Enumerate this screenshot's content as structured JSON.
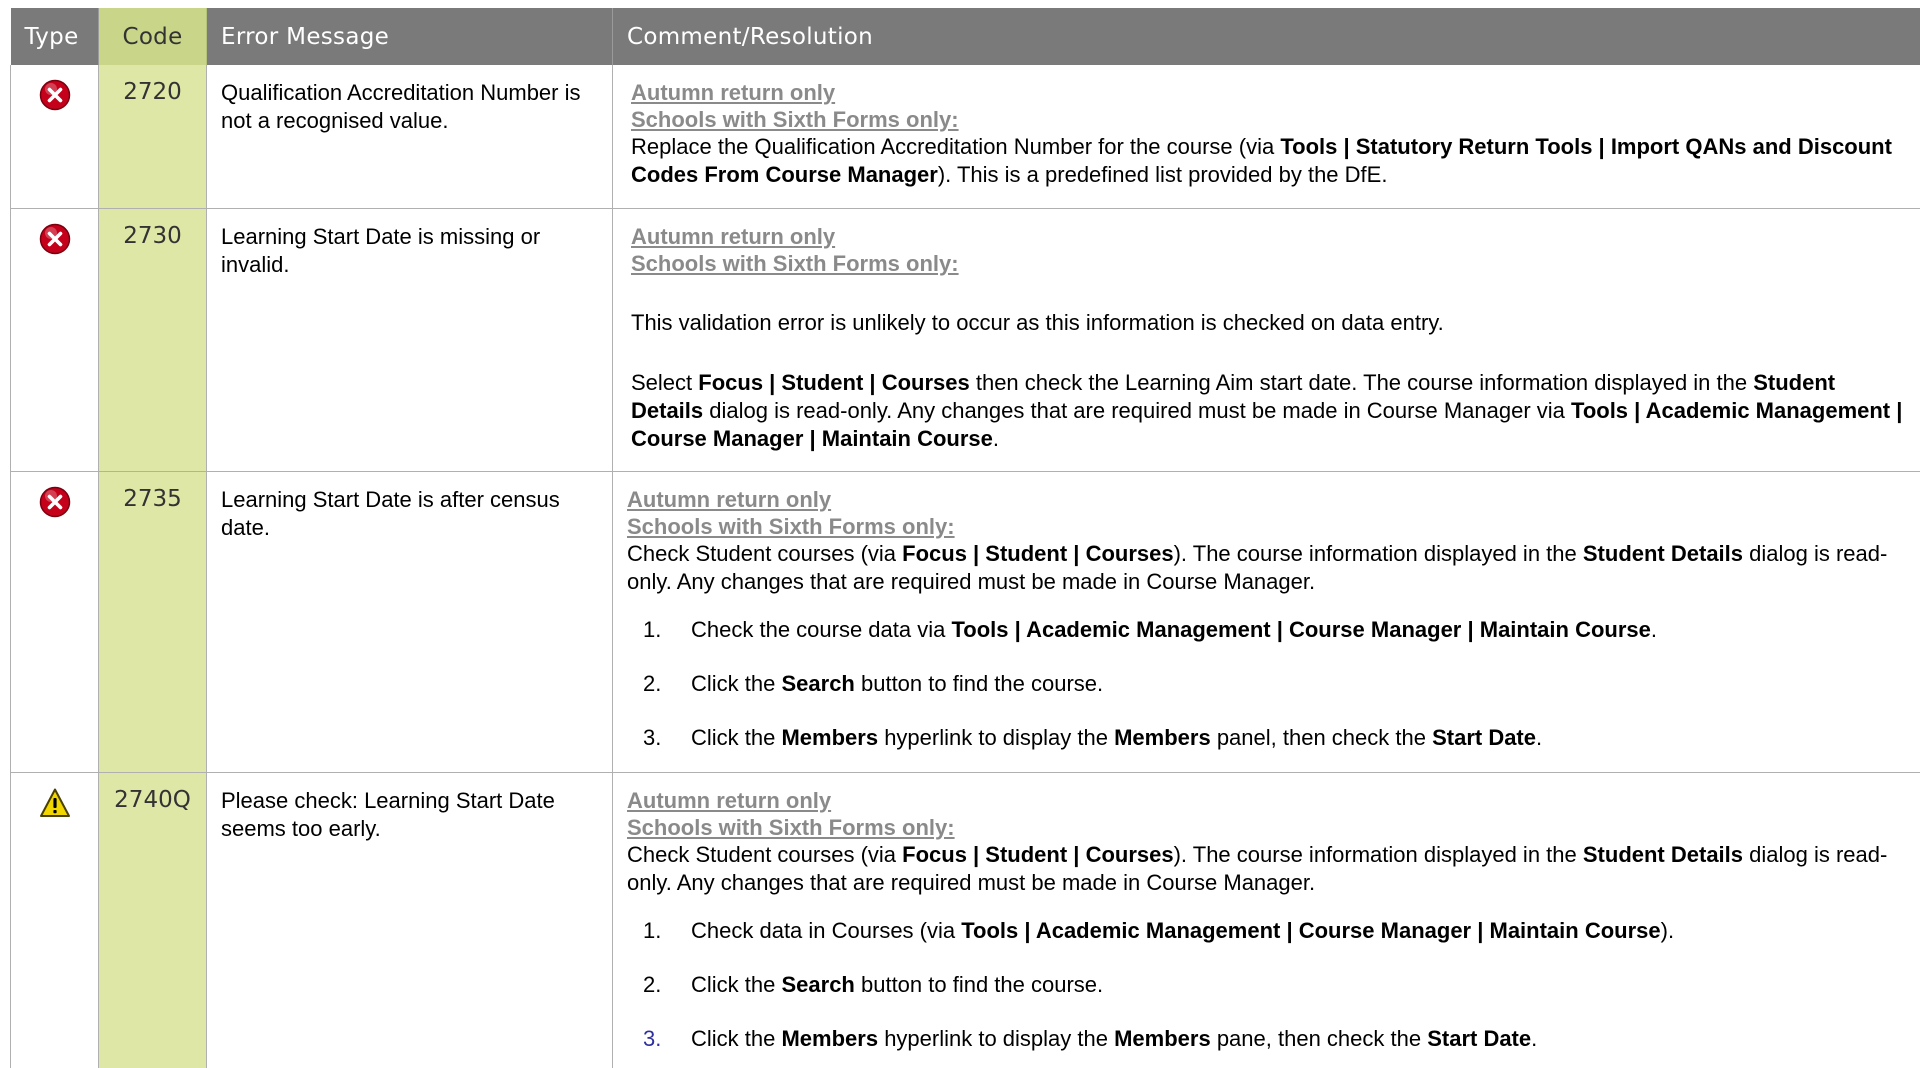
{
  "colors": {
    "header_bg": "#7a7a7a",
    "code_header_bg": "#c9d68a",
    "code_column_bg": "#dfe7a6",
    "flag_text": "#8a8a8a",
    "error_icon": "#c4001a",
    "warning_icon": "#f2d600"
  },
  "header": {
    "type": "Type",
    "code": "Code",
    "message": "Error Message",
    "comment": "Comment/Resolution"
  },
  "rows": [
    {
      "icon": "error-icon",
      "code": "2720",
      "message": "Qualification Accreditation Number is not a recognised value.",
      "flags": [
        "Autumn return only",
        "Schools with Sixth Forms only:"
      ],
      "p1": {
        "t1": "Replace the Qualification Accreditation Number for the course (via ",
        "b1": "Tools | Statutory Return Tools | Import QANs and Discount Codes From Course Manager",
        "t2": "). This is a predefined list provided by the DfE."
      }
    },
    {
      "icon": "error-icon",
      "code": "2730",
      "message": "Learning Start Date is missing or invalid.",
      "flags": [
        "Autumn return only",
        "Schools with Sixth Forms only:"
      ],
      "p1": "This validation error is unlikely to occur as this information is checked on data entry.",
      "p2": {
        "t1": "Select ",
        "b1": "Focus | Student | Courses",
        "t2": " then check the Learning Aim start date. The course information displayed in the ",
        "b2": "Student Details",
        "t3": " dialog is read-only. Any changes that are required must be made in Course Manager via ",
        "b3": "Tools | Academic Management | Course Manager | Maintain Course",
        "t4": "."
      }
    },
    {
      "icon": "error-icon",
      "code": "2735",
      "message": "Learning Start Date is after census date.",
      "flags": [
        "Autumn return only",
        "Schools with Sixth Forms only:"
      ],
      "p1": {
        "t1": "Check Student courses (via ",
        "b1": "Focus | Student | Courses",
        "t2": "). The course information displayed in the ",
        "b2": "Student Details",
        "t3": " dialog is read-only. Any changes that are required must be made in Course Manager."
      },
      "steps": [
        {
          "num": "1.",
          "t1": "Check the course data via ",
          "b1": "Tools | Academic Management | Course Manager | Maintain Course",
          "t2": ".",
          "b2": "",
          "t3": "",
          "b3": "",
          "t4": ""
        },
        {
          "num": "2.",
          "t1": "Click the ",
          "b1": "Search",
          "t2": " button to find the course.",
          "b2": "",
          "t3": "",
          "b3": "",
          "t4": ""
        },
        {
          "num": "3.",
          "t1": "Click the ",
          "b1": "Members",
          "t2": " hyperlink to display the ",
          "b2": "Members",
          "t3": " panel, then check the ",
          "b3": "Start Date",
          "t4": "."
        }
      ]
    },
    {
      "icon": "warning-icon",
      "code": "2740Q",
      "message": "Please check: Learning Start Date seems too early.",
      "flags": [
        "Autumn return only",
        "Schools with Sixth Forms only:"
      ],
      "p1": {
        "t1": "Check Student courses (via ",
        "b1": "Focus | Student | Courses",
        "t2": "). The course information displayed in the ",
        "b2": "Student Details",
        "t3": " dialog is read-only. Any changes that are required must be made in Course Manager."
      },
      "steps": [
        {
          "num": "1.",
          "t1": "Check data in Courses (via ",
          "b1": "Tools | Academic Management | Course Manager | Maintain Course",
          "t2": ").",
          "b2": "",
          "t3": "",
          "b3": "",
          "t4": ""
        },
        {
          "num": "2.",
          "t1": "Click the ",
          "b1": "Search",
          "t2": " button to find the course.",
          "b2": "",
          "t3": "",
          "b3": "",
          "t4": ""
        },
        {
          "num": "3.",
          "t1": "Click the ",
          "b1": "Members",
          "t2": " hyperlink to display the ",
          "b2": "Members",
          "t3": " pane, then check the ",
          "b3": "Start Date",
          "t4": "."
        }
      ]
    }
  ]
}
